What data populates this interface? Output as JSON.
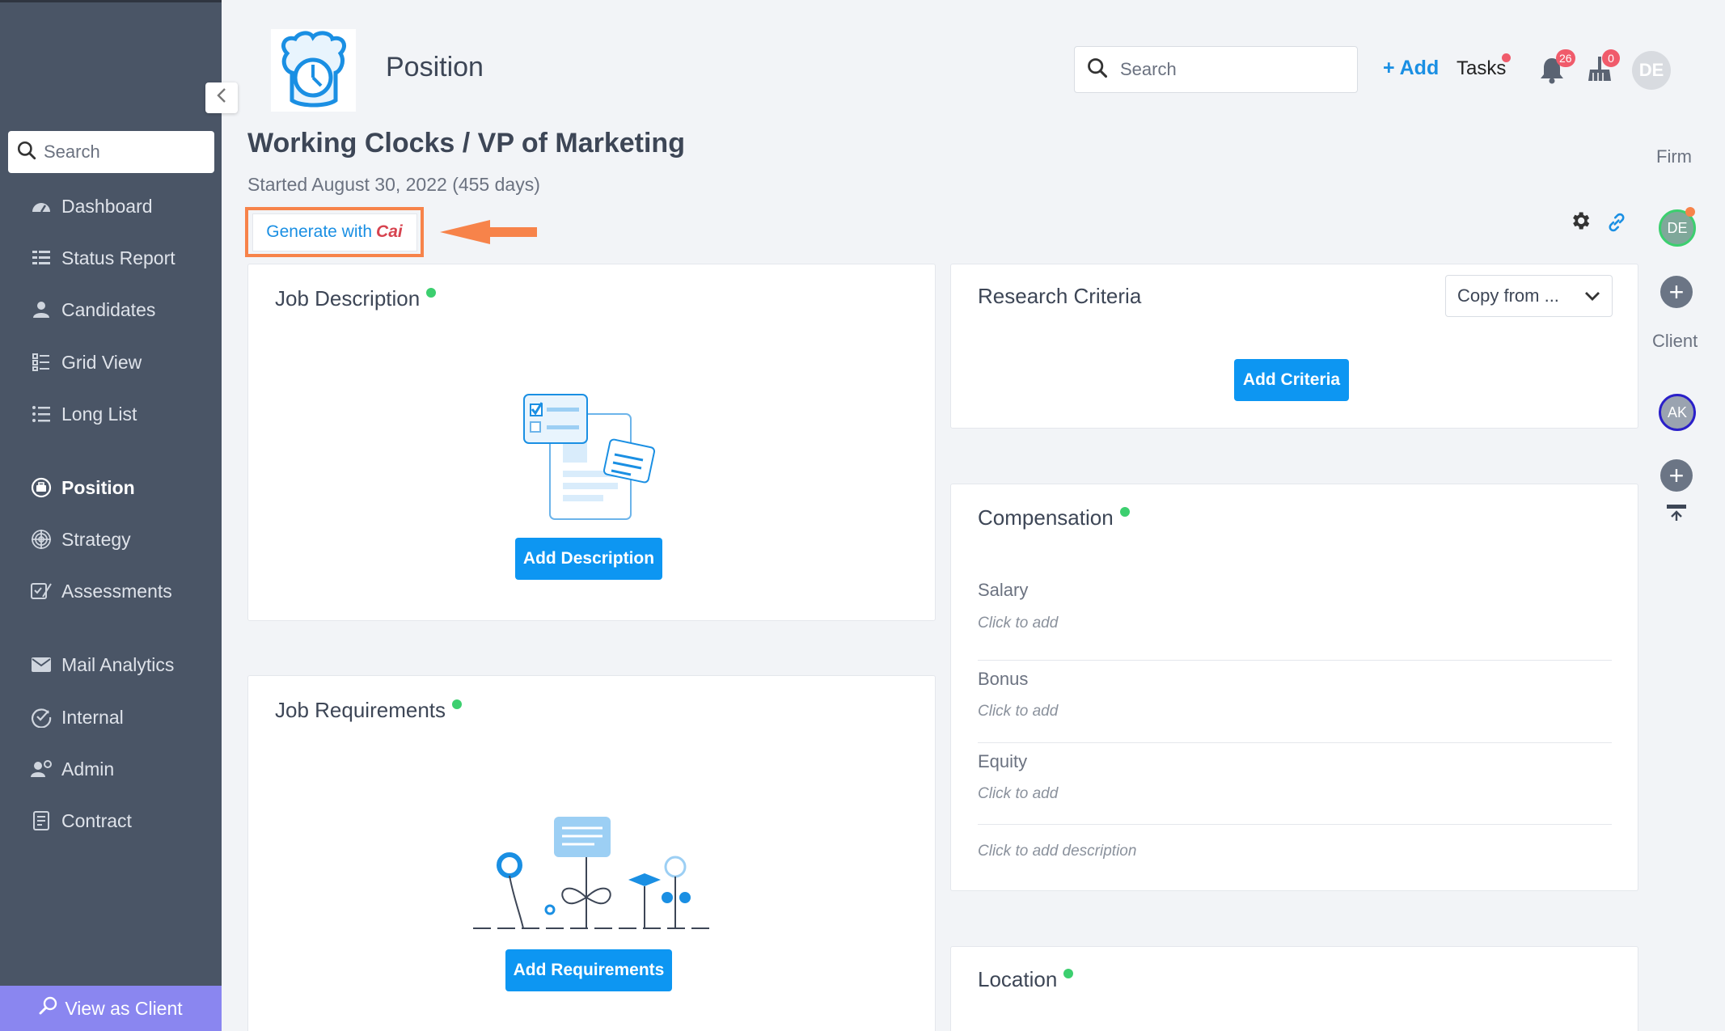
{
  "sidebar": {
    "search_placeholder": "Search",
    "items": [
      {
        "label": "Dashboard"
      },
      {
        "label": "Status Report"
      },
      {
        "label": "Candidates"
      },
      {
        "label": "Grid View"
      },
      {
        "label": "Long List"
      },
      {
        "label": "Position"
      },
      {
        "label": "Strategy"
      },
      {
        "label": "Assessments"
      },
      {
        "label": "Mail Analytics"
      },
      {
        "label": "Internal"
      },
      {
        "label": "Admin"
      },
      {
        "label": "Contract"
      }
    ],
    "view_as_client": "View as Client"
  },
  "header": {
    "page_name": "Position",
    "search_placeholder": "Search",
    "add_label": "+ Add",
    "tasks_label": "Tasks",
    "notifications_count": "26",
    "cleanup_count": "0",
    "avatar_initials": "DE"
  },
  "position": {
    "title": "Working Clocks / VP of Marketing",
    "started": "Started August 30, 2022 (455 days)",
    "generate_label": "Generate with",
    "generate_brand": "Cai"
  },
  "cards": {
    "job_description": {
      "title": "Job Description",
      "button": "Add Description"
    },
    "job_requirements": {
      "title": "Job Requirements",
      "button": "Add Requirements"
    },
    "research_criteria": {
      "title": "Research Criteria",
      "copy_from": "Copy from ...",
      "button": "Add Criteria"
    },
    "compensation": {
      "title": "Compensation",
      "fields": [
        {
          "label": "Salary",
          "value": "Click to add"
        },
        {
          "label": "Bonus",
          "value": "Click to add"
        },
        {
          "label": "Equity",
          "value": "Click to add"
        }
      ],
      "description": "Click to add description"
    },
    "location": {
      "title": "Location"
    }
  },
  "rail": {
    "firm_label": "Firm",
    "firm_avatar": "DE",
    "client_label": "Client",
    "client_avatar": "AK"
  },
  "colors": {
    "accent": "#0d96f2",
    "sidebar": "#4a5566",
    "highlight": "#f7834a",
    "status_green": "#3ccf6f",
    "badge_red": "#f05b6b"
  }
}
